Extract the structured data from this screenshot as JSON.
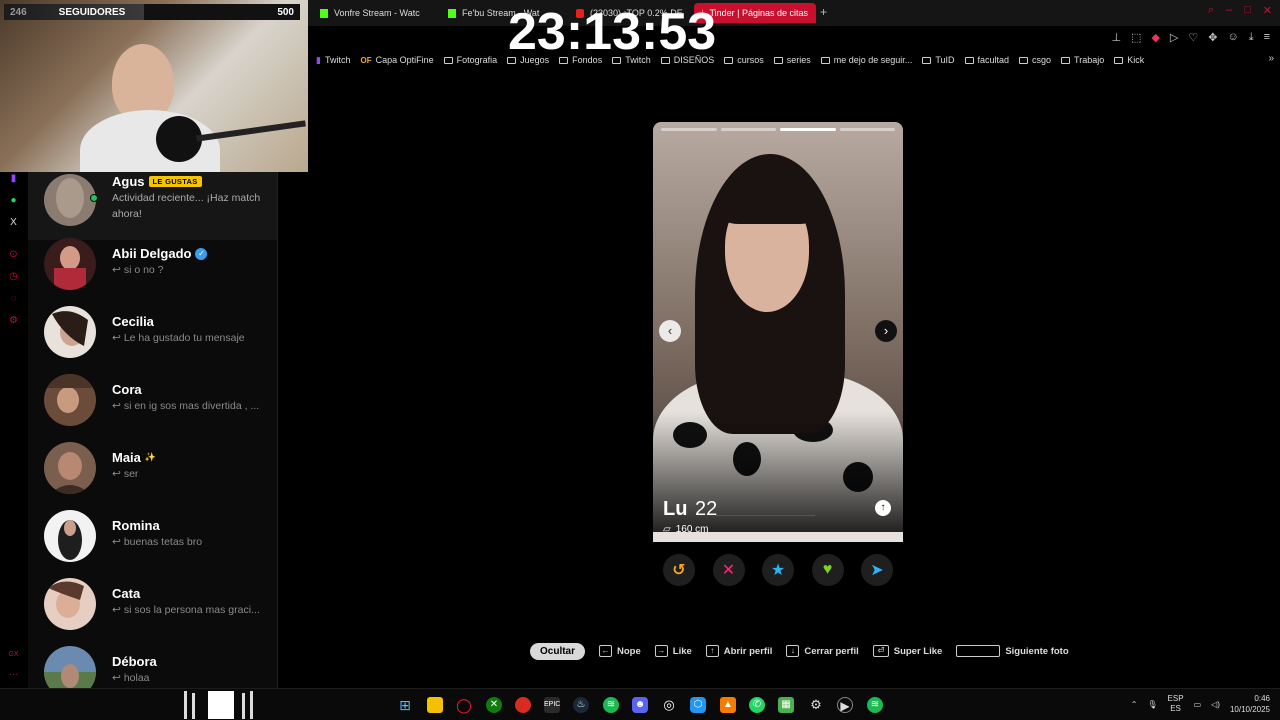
{
  "stream": {
    "clock": "23:13:53",
    "followers_count_left": "246",
    "followers_label": "SEGUIDORES",
    "followers_goal": "500"
  },
  "browser": {
    "tabs": [
      {
        "label": "Vonfre Stream - Watc",
        "active": false
      },
      {
        "label": "Fe'bu Stream - Wat",
        "active": false
      },
      {
        "label": "(23030) ¡TOP 0.2% DE",
        "active": false
      },
      {
        "label": "Tinder | Páginas de citas",
        "active": true
      }
    ],
    "new_tab": "+",
    "bookmarks": [
      "Twitch",
      "Capa OptiFine",
      "Fotografia",
      "Juegos",
      "Fondos",
      "Twitch",
      "DISEÑOS",
      "cursos",
      "series",
      "me dejo de seguir...",
      "TuID",
      "facultad",
      "csgo",
      "Trabajo",
      "Kick"
    ],
    "bookmarks_more": "»"
  },
  "chats": [
    {
      "name": "Agus",
      "badge": "LE GUSTAS",
      "message": "Actividad reciente... ¡Haz match ahora!",
      "avatar_color": "#8a7c70"
    },
    {
      "name": "Abii Delgado",
      "verified": true,
      "message": "si o no ?",
      "avatar_color": "#b02a3a"
    },
    {
      "name": "Cecilia",
      "message": "Le ha gustado tu mensaje",
      "avatar_color": "#c9b4a4"
    },
    {
      "name": "Cora",
      "message": "si en ig sos mas divertida , ...",
      "avatar_color": "#6b4c3a"
    },
    {
      "name": "Maia",
      "emoji": "✨",
      "message": "ser",
      "avatar_color": "#7a5e4e"
    },
    {
      "name": "Romina",
      "message": "buenas tetas bro",
      "avatar_color": "#2a2a2a"
    },
    {
      "name": "Cata",
      "message": "si sos la persona mas graci...",
      "avatar_color": "#d8b8a8"
    },
    {
      "name": "Débora",
      "message": "holaa",
      "avatar_color": "#5a7a4a"
    }
  ],
  "profile": {
    "name": "Lu",
    "age": "22",
    "height": "160 cm",
    "photo_count": 4,
    "photo_index": 3
  },
  "actions": [
    {
      "name": "rewind",
      "glyph": "↺",
      "color": "#f5a623"
    },
    {
      "name": "nope",
      "glyph": "✕",
      "color": "#fd267d"
    },
    {
      "name": "super-like",
      "glyph": "★",
      "color": "#2cb5f5"
    },
    {
      "name": "like",
      "glyph": "♥",
      "color": "#7ed321"
    },
    {
      "name": "boost",
      "glyph": "➤",
      "color": "#2cb5f5"
    }
  ],
  "shortcuts": {
    "hide": "Ocultar",
    "items": [
      {
        "key": "←",
        "label": "Nope"
      },
      {
        "key": "→",
        "label": "Like"
      },
      {
        "key": "↑",
        "label": "Abrir perfil"
      },
      {
        "key": "↓",
        "label": "Cerrar perfil"
      },
      {
        "key": "⏎",
        "label": "Super Like"
      },
      {
        "key": "",
        "label": "Siguiente foto"
      }
    ]
  },
  "taskbar": {
    "lang": "ESP",
    "lang_sub": "ES",
    "time": "0:46",
    "date": "10/10/2025"
  }
}
